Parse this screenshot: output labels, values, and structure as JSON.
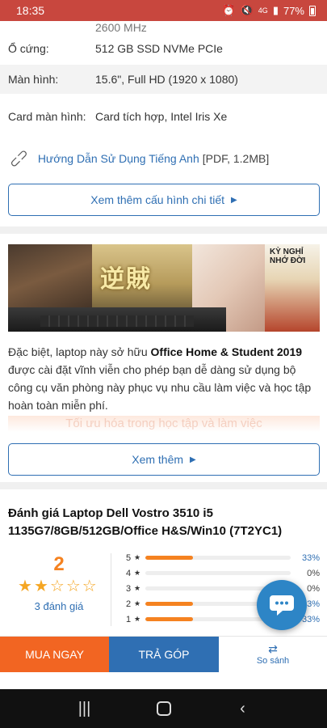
{
  "status_bar": {
    "time": "18:35",
    "network": "4G",
    "battery_percent": "77%",
    "background_color": "#c8473e"
  },
  "specs": [
    {
      "key": "",
      "value": "2600 MHz"
    },
    {
      "key": "Ổ cứng:",
      "value": "512 GB SSD NVMe PCIe"
    },
    {
      "key": "Màn hình:",
      "value": "15.6\", Full HD (1920 x 1080)"
    },
    {
      "key": "Card màn hình:",
      "value": "Card tích hợp, Intel Iris Xe"
    }
  ],
  "manual": {
    "icon": "link-icon",
    "text": "Hướng Dẫn Sử Dụng Tiếng Anh",
    "meta": "[PDF, 1.2MB]"
  },
  "config_button": {
    "label": "Xem thêm cấu hình chi tiết"
  },
  "promo": {
    "poster_title_jp": "逆賊",
    "poster_title_vn": "KỲ NGHỈ NHỚ ĐỜI",
    "text_prefix": "Đặc biệt, laptop này sở hữu ",
    "text_bold": "Office Home & Student 2019",
    "text_suffix": " được cài đặt vĩnh viễn cho phép bạn dễ dàng sử dụng bộ công cụ văn phòng này phục vụ nhu cầu làm việc và học tập hoàn toàn miễn phí.",
    "faded_heading": "Tối ưu hóa trong học tập và làm việc"
  },
  "more_button": {
    "label": "Xem thêm"
  },
  "review": {
    "title": "Đánh giá Laptop Dell Vostro 3510 i5 1135G7/8GB/512GB/Office H&S/Win10 (7T2YC1)",
    "average": "2",
    "stars_filled": 2,
    "stars_total": 5,
    "count_label": "3 đánh giá",
    "breakdown": [
      {
        "star": "5",
        "percent": 33,
        "label": "33%"
      },
      {
        "star": "4",
        "percent": 0,
        "label": "0%"
      },
      {
        "star": "3",
        "percent": 0,
        "label": "0%"
      },
      {
        "star": "2",
        "percent": 33,
        "label": "33%"
      },
      {
        "star": "1",
        "percent": 33,
        "label": "33%"
      }
    ]
  },
  "actions": {
    "buy_now": "MUA NGAY",
    "installment": "TRẢ GÓP",
    "compare": "So sánh",
    "buy_color": "#f26522",
    "installment_color": "#2f6fb3"
  }
}
